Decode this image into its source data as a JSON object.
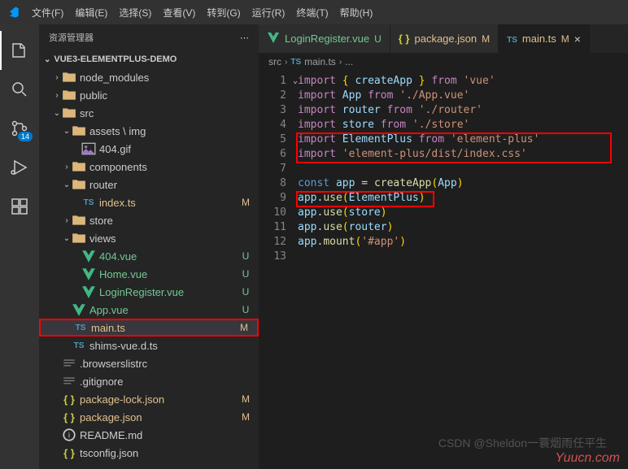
{
  "menu": {
    "items": [
      "文件(F)",
      "编辑(E)",
      "选择(S)",
      "查看(V)",
      "转到(G)",
      "运行(R)",
      "终端(T)",
      "帮助(H)"
    ]
  },
  "activityBar": {
    "scmBadge": "14"
  },
  "sidebar": {
    "title": "资源管理器",
    "project": "VUE3-ELEMENTPLUS-DEMO"
  },
  "tree": [
    {
      "indent": 1,
      "chev": ">",
      "icon": "folder",
      "label": "node_modules",
      "dim": true
    },
    {
      "indent": 1,
      "chev": ">",
      "icon": "folder",
      "label": "public"
    },
    {
      "indent": 1,
      "chev": "v",
      "icon": "folder",
      "label": "src"
    },
    {
      "indent": 2,
      "chev": "v",
      "icon": "folder",
      "label": "assets \\ img"
    },
    {
      "indent": 3,
      "chev": "",
      "icon": "img",
      "label": "404.gif"
    },
    {
      "indent": 2,
      "chev": ">",
      "icon": "folder",
      "label": "components"
    },
    {
      "indent": 2,
      "chev": "v",
      "icon": "folder",
      "label": "router"
    },
    {
      "indent": 3,
      "chev": "",
      "icon": "ts",
      "label": "index.ts",
      "git": "M"
    },
    {
      "indent": 2,
      "chev": ">",
      "icon": "folder",
      "label": "store"
    },
    {
      "indent": 2,
      "chev": "v",
      "icon": "folder",
      "label": "views"
    },
    {
      "indent": 3,
      "chev": "",
      "icon": "vue",
      "label": "404.vue",
      "git": "U"
    },
    {
      "indent": 3,
      "chev": "",
      "icon": "vue",
      "label": "Home.vue",
      "git": "U"
    },
    {
      "indent": 3,
      "chev": "",
      "icon": "vue",
      "label": "LoginRegister.vue",
      "git": "U"
    },
    {
      "indent": 2,
      "chev": "",
      "icon": "vue",
      "label": "App.vue",
      "git": "U"
    },
    {
      "indent": 2,
      "chev": "",
      "icon": "ts",
      "label": "main.ts",
      "git": "M",
      "selected": true,
      "red": true
    },
    {
      "indent": 2,
      "chev": "",
      "icon": "ts",
      "label": "shims-vue.d.ts"
    },
    {
      "indent": 1,
      "chev": "",
      "icon": "text",
      "label": ".browserslistrc"
    },
    {
      "indent": 1,
      "chev": "",
      "icon": "text",
      "label": ".gitignore"
    },
    {
      "indent": 1,
      "chev": "",
      "icon": "json",
      "label": "package-lock.json",
      "git": "M"
    },
    {
      "indent": 1,
      "chev": "",
      "icon": "json",
      "label": "package.json",
      "git": "M"
    },
    {
      "indent": 1,
      "chev": "",
      "icon": "readme",
      "label": "README.md"
    },
    {
      "indent": 1,
      "chev": "",
      "icon": "json",
      "label": "tsconfig.json"
    }
  ],
  "tabs": [
    {
      "icon": "vue",
      "label": "LoginRegister.vue",
      "status": "U",
      "git": "untracked"
    },
    {
      "icon": "json",
      "label": "package.json",
      "status": "M",
      "git": "modified"
    },
    {
      "icon": "ts",
      "label": "main.ts",
      "status": "M",
      "git": "modified",
      "active": true,
      "close": true
    }
  ],
  "breadcrumb": {
    "parts": [
      "src",
      "main.ts",
      "..."
    ],
    "icon": "ts"
  },
  "code": {
    "lines": [
      [
        {
          "c": "tk-keyword",
          "t": "import"
        },
        {
          "c": "tk-default",
          "t": " "
        },
        {
          "c": "tk-brace",
          "t": "{"
        },
        {
          "c": "tk-default",
          "t": " "
        },
        {
          "c": "tk-ident",
          "t": "createApp"
        },
        {
          "c": "tk-default",
          "t": " "
        },
        {
          "c": "tk-brace",
          "t": "}"
        },
        {
          "c": "tk-default",
          "t": " "
        },
        {
          "c": "tk-keyword",
          "t": "from"
        },
        {
          "c": "tk-default",
          "t": " "
        },
        {
          "c": "tk-string",
          "t": "'vue'"
        }
      ],
      [
        {
          "c": "tk-keyword",
          "t": "import"
        },
        {
          "c": "tk-default",
          "t": " "
        },
        {
          "c": "tk-ident",
          "t": "App"
        },
        {
          "c": "tk-default",
          "t": " "
        },
        {
          "c": "tk-keyword",
          "t": "from"
        },
        {
          "c": "tk-default",
          "t": " "
        },
        {
          "c": "tk-string",
          "t": "'./App.vue'"
        }
      ],
      [
        {
          "c": "tk-keyword",
          "t": "import"
        },
        {
          "c": "tk-default",
          "t": " "
        },
        {
          "c": "tk-ident",
          "t": "router"
        },
        {
          "c": "tk-default",
          "t": " "
        },
        {
          "c": "tk-keyword",
          "t": "from"
        },
        {
          "c": "tk-default",
          "t": " "
        },
        {
          "c": "tk-string",
          "t": "'./router'"
        }
      ],
      [
        {
          "c": "tk-keyword",
          "t": "import"
        },
        {
          "c": "tk-default",
          "t": " "
        },
        {
          "c": "tk-ident",
          "t": "store"
        },
        {
          "c": "tk-default",
          "t": " "
        },
        {
          "c": "tk-keyword",
          "t": "from"
        },
        {
          "c": "tk-default",
          "t": " "
        },
        {
          "c": "tk-string",
          "t": "'./store'"
        }
      ],
      [
        {
          "c": "tk-keyword",
          "t": "import"
        },
        {
          "c": "tk-default",
          "t": " "
        },
        {
          "c": "tk-ident",
          "t": "ElementPlus"
        },
        {
          "c": "tk-default",
          "t": " "
        },
        {
          "c": "tk-keyword",
          "t": "from"
        },
        {
          "c": "tk-default",
          "t": " "
        },
        {
          "c": "tk-string",
          "t": "'element-plus'"
        }
      ],
      [
        {
          "c": "tk-keyword",
          "t": "import"
        },
        {
          "c": "tk-default",
          "t": " "
        },
        {
          "c": "tk-string",
          "t": "'element-plus/dist/index.css'"
        }
      ],
      [],
      [
        {
          "c": "tk-const",
          "t": "const"
        },
        {
          "c": "tk-default",
          "t": " "
        },
        {
          "c": "tk-ident",
          "t": "app"
        },
        {
          "c": "tk-default",
          "t": " = "
        },
        {
          "c": "tk-func",
          "t": "createApp"
        },
        {
          "c": "tk-brace",
          "t": "("
        },
        {
          "c": "tk-ident",
          "t": "App"
        },
        {
          "c": "tk-brace",
          "t": ")"
        }
      ],
      [
        {
          "c": "tk-ident",
          "t": "app"
        },
        {
          "c": "tk-default",
          "t": "."
        },
        {
          "c": "tk-func",
          "t": "use"
        },
        {
          "c": "tk-brace",
          "t": "("
        },
        {
          "c": "tk-ident",
          "t": "ElementPlus"
        },
        {
          "c": "tk-brace",
          "t": ")"
        }
      ],
      [
        {
          "c": "tk-ident",
          "t": "app"
        },
        {
          "c": "tk-default",
          "t": "."
        },
        {
          "c": "tk-func",
          "t": "use"
        },
        {
          "c": "tk-brace",
          "t": "("
        },
        {
          "c": "tk-ident",
          "t": "store"
        },
        {
          "c": "tk-brace",
          "t": ")"
        }
      ],
      [
        {
          "c": "tk-ident",
          "t": "app"
        },
        {
          "c": "tk-default",
          "t": "."
        },
        {
          "c": "tk-func",
          "t": "use"
        },
        {
          "c": "tk-brace",
          "t": "("
        },
        {
          "c": "tk-ident",
          "t": "router"
        },
        {
          "c": "tk-brace",
          "t": ")"
        }
      ],
      [
        {
          "c": "tk-ident",
          "t": "app"
        },
        {
          "c": "tk-default",
          "t": "."
        },
        {
          "c": "tk-func",
          "t": "mount"
        },
        {
          "c": "tk-brace",
          "t": "("
        },
        {
          "c": "tk-string",
          "t": "'#app'"
        },
        {
          "c": "tk-brace",
          "t": ")"
        }
      ],
      []
    ]
  },
  "watermark": {
    "csdn": "CSDN @Sheldon一蓑烟雨任平生",
    "yuucn": "Yuucn.com"
  }
}
